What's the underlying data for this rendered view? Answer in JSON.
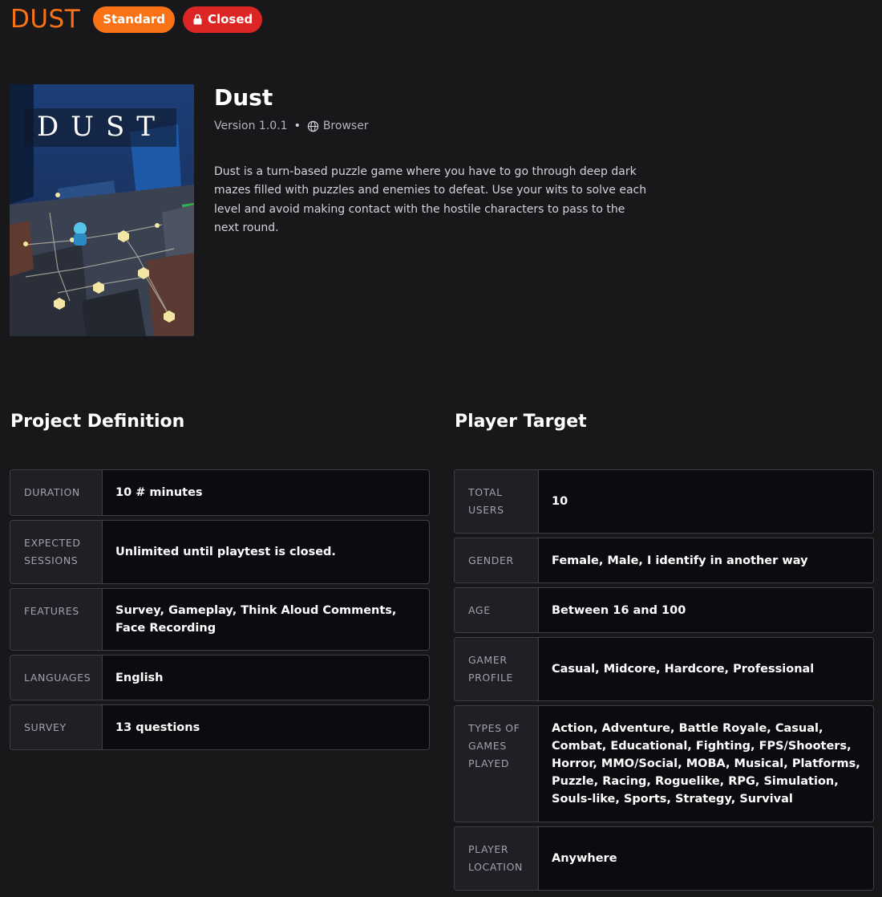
{
  "header": {
    "brand": "DUST",
    "badge_standard": "Standard",
    "badge_closed": "Closed"
  },
  "game": {
    "cover_title": "DUST",
    "title": "Dust",
    "version": "Version 1.0.1",
    "platform": "Browser",
    "description": "Dust is a turn-based puzzle game where you have to go through deep dark mazes filled with puzzles and enemies to defeat. Use your wits to solve each level and avoid making contact with the hostile characters to pass to the next round."
  },
  "project_definition": {
    "title": "Project Definition",
    "rows": [
      {
        "label": "DURATION",
        "value": "10 # minutes"
      },
      {
        "label": "EXPECTED SESSIONS",
        "value": "Unlimited until playtest is closed."
      },
      {
        "label": "FEATURES",
        "value": "Survey, Gameplay, Think Aloud Comments, Face Recording"
      },
      {
        "label": "LANGUAGES",
        "value": "English"
      },
      {
        "label": "SURVEY",
        "value": "13 questions"
      }
    ]
  },
  "player_target": {
    "title": "Player Target",
    "rows": [
      {
        "label": "TOTAL USERS",
        "value": "10"
      },
      {
        "label": "GENDER",
        "value": "Female, Male, I identify in another way"
      },
      {
        "label": "AGE",
        "value": "Between 16 and 100"
      },
      {
        "label": "GAMER PROFILE",
        "value": "Casual, Midcore, Hardcore, Professional"
      },
      {
        "label": "TYPES OF GAMES PLAYED",
        "value": "Action, Adventure, Battle Royale, Casual, Combat, Educational, Fighting, FPS/Shooters, Horror, MMO/Social, MOBA, Musical, Platforms, Puzzle, Racing, Roguelike, RPG, Simulation, Souls-like, Sports, Strategy, Survival"
      },
      {
        "label": "PLAYER LOCATION",
        "value": "Anywhere"
      }
    ]
  },
  "colors": {
    "accent": "#f97316",
    "closed": "#dc2626",
    "background": "#18181b",
    "cell_key_bg": "#1f2026",
    "cell_value_bg": "#0b0c10"
  },
  "icons": {
    "closed_badge": "lock-icon",
    "platform": "globe-icon"
  }
}
